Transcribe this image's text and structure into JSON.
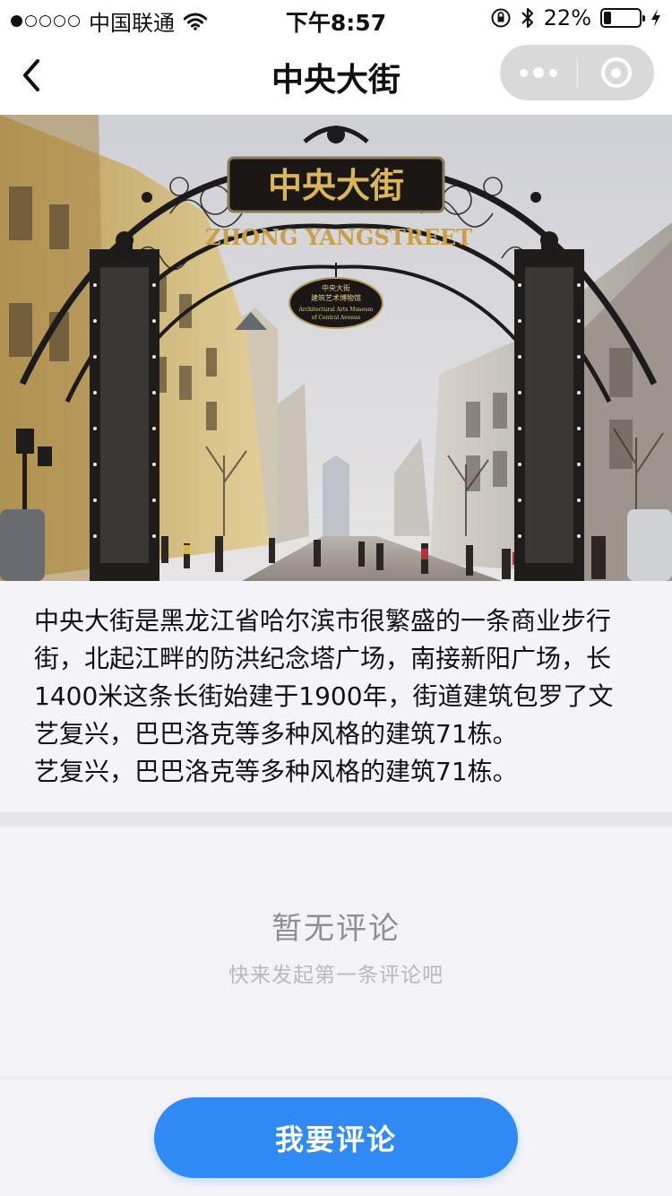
{
  "status_bar": {
    "carrier": "中国联通",
    "time": "下午8:57",
    "battery": "22%",
    "battery_level": 0.22,
    "signal_bars": 1,
    "icons": [
      "wifi-icon",
      "orientation-lock-icon",
      "bluetooth-icon",
      "battery-icon",
      "charging-icon"
    ]
  },
  "nav": {
    "title": "中央大街",
    "icons": [
      "back-chevron-icon",
      "more-dots-icon",
      "close-target-icon"
    ]
  },
  "hero": {
    "sign_text": "中央大街",
    "arch_text": "ZHONG YANGSTREET",
    "plaque_line1": "中央大街",
    "plaque_line2": "建筑艺术博物馆",
    "plaque_line3": "Architectural Arts Museum",
    "plaque_line4": "of Central Avenue"
  },
  "description": {
    "paragraph": "中央大街是黑龙江省哈尔滨市很繁盛的一条商业步行街，北起江畔的防洪纪念塔广场，南接新阳广场，长1400米这条长街始建于1900年，街道建筑包罗了文艺复兴，巴巴洛克等多种风格的建筑71栋。",
    "extra_line": "艺复兴，巴巴洛克等多种风格的建筑71栋。"
  },
  "comments": {
    "empty_title": "暂无评论",
    "empty_subtitle": "快来发起第一条评论吧"
  },
  "footer": {
    "comment_button": "我要评论"
  },
  "colors": {
    "primary": "#2f8af6",
    "page_bg": "#f4f4f8",
    "muted_text": "#8e8e93"
  }
}
